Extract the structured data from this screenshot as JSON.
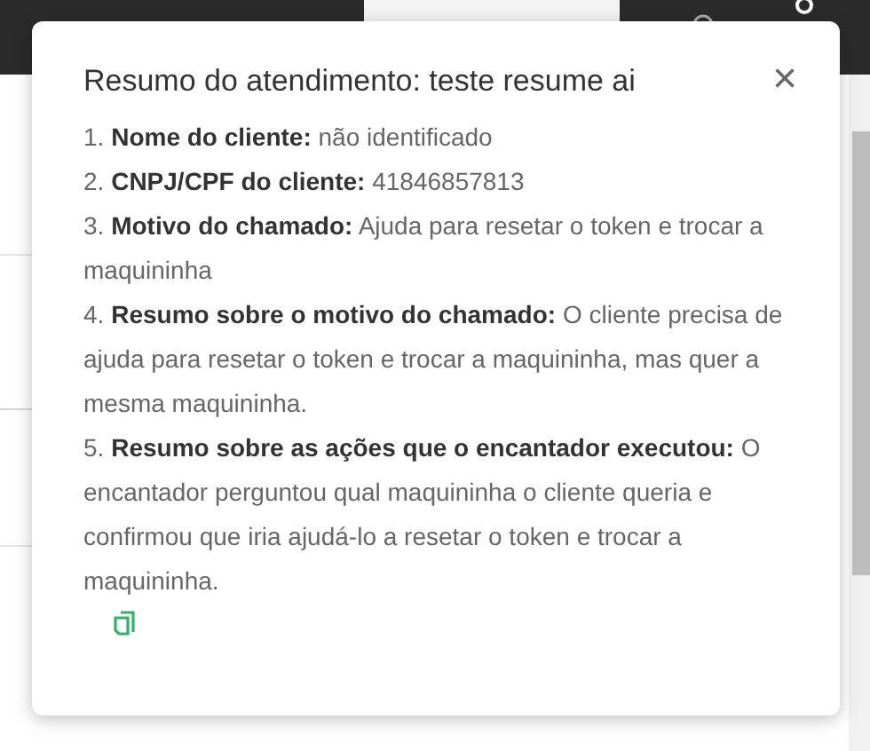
{
  "dialog": {
    "title": "Resumo do atendimento: teste resume ai",
    "close": "×",
    "items": [
      "1. **Nome do cliente:** não identificado",
      "2. **CNPJ/CPF do cliente:** 41846857813",
      "3. **Motivo do chamado:** Ajuda para resetar o token e trocar a maquininha",
      "4. **Resumo sobre o motivo do chamado:** O cliente precisa de ajuda para resetar o token e trocar a maquininha, mas quer a mesma maquininha.",
      "5. **Resumo sobre as ações que o encantador executou:** O encantador perguntou qual maquininha o cliente queria e confirmou que iria ajudá-lo a resetar o token e trocar a maquininha."
    ]
  }
}
